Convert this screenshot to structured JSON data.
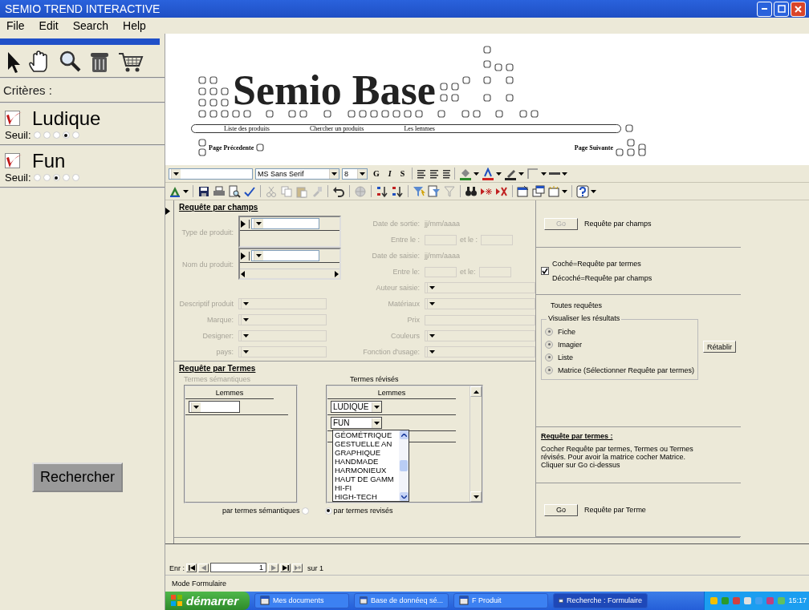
{
  "window": {
    "title": "SEMIO TREND INTERACTIVE"
  },
  "menu": [
    {
      "label": "File"
    },
    {
      "label": "Edit"
    },
    {
      "label": "Search"
    },
    {
      "label": "Help"
    }
  ],
  "criteria_panel": {
    "heading": "Critères :",
    "criteria": [
      {
        "name": "Ludique",
        "checked": true,
        "threshold_label": "Seuil:",
        "threshold": [
          {
            "selected": false
          },
          {
            "selected": false
          },
          {
            "selected": false
          },
          {
            "selected": true
          },
          {
            "selected": false
          }
        ]
      },
      {
        "name": "Fun",
        "checked": true,
        "threshold_label": "Seuil:",
        "threshold": [
          {
            "selected": false
          },
          {
            "selected": false
          },
          {
            "selected": true
          },
          {
            "selected": false
          },
          {
            "selected": false
          }
        ]
      }
    ],
    "search_button": "Rechercher"
  },
  "header": {
    "logo": "Semio Base",
    "nav_links": [
      "Liste des produits",
      "Chercher un produits",
      "Les lemmes"
    ],
    "previous_page": "Page Précedente",
    "next_page": "Page Suivante"
  },
  "format_toolbar": {
    "font": "MS Sans Serif",
    "size": "8",
    "style_buttons": [
      "G",
      "I",
      "S"
    ]
  },
  "form": {
    "fields_query": {
      "title": "Requête par champs",
      "left_fields": [
        {
          "kind": "subform",
          "label": "Type de produit:",
          "disabled": true
        },
        {
          "kind": "subform_scroll",
          "label": "Nom du produit:",
          "disabled": true
        },
        {
          "kind": "combo",
          "label": "Descriptif produit",
          "disabled": true
        },
        {
          "kind": "combo",
          "label": "Marque:",
          "disabled": true
        },
        {
          "kind": "combo",
          "label": "Designer:",
          "disabled": true
        },
        {
          "kind": "combo",
          "label": "pays:",
          "disabled": true
        }
      ],
      "right_fields": [
        {
          "kind": "hint",
          "label": "Date de sortie:",
          "hint": "jj/mm/aaaa",
          "disabled": true
        },
        {
          "kind": "range",
          "label": "Entre le :",
          "label_2": "et le :",
          "disabled": true
        },
        {
          "kind": "hint",
          "label": "Date de saisie:",
          "hint": "jj/mm/aaaa",
          "disabled": true
        },
        {
          "kind": "range",
          "label": "Entre le:",
          "label_2": "et le:",
          "disabled": true
        },
        {
          "kind": "combo",
          "label": "Auteur saisie:",
          "disabled": true
        },
        {
          "kind": "combo",
          "label": "Matériaux",
          "disabled": true
        },
        {
          "kind": "text",
          "label": "Prix",
          "disabled": true
        },
        {
          "kind": "combo",
          "label": "Couleurs",
          "disabled": true
        },
        {
          "kind": "combo",
          "label": "Fonction d'usage:",
          "disabled": true
        }
      ]
    },
    "terms_query": {
      "title": "Requête par Termes",
      "semantic": {
        "label": "Termes sémantiques",
        "disabled": true,
        "column": "Lemmes"
      },
      "revised": {
        "label": "Termes révisés",
        "column": "Lemmes",
        "rows": [
          "LUDIQUE",
          "FUN"
        ],
        "dropdown": [
          "GÉOMÉTRIQUE",
          "GESTUELLE AN",
          "GRAPHIQUE",
          "HANDMADE",
          "HARMONIEUX",
          "HAUT DE GAMM",
          "HI-FI",
          "HIGH-TECH"
        ]
      },
      "modes": [
        {
          "label": "par termes sémantiques",
          "selected": false
        },
        {
          "label": "par termes revisés",
          "selected": true
        }
      ]
    },
    "side": [
      {
        "kind": "go",
        "button": "Go",
        "disabled": true,
        "label": "Requête par champs"
      },
      {
        "kind": "checkbox",
        "checked": true,
        "lines": [
          "Coché=Requête par termes",
          "Décoché=Requête par champs"
        ]
      },
      {
        "kind": "view",
        "title": "Toutes requêtes",
        "group": "Visualiser les résultats",
        "options": [
          {
            "label": "Fiche",
            "selected": true
          },
          {
            "label": "Imagier",
            "selected": true
          },
          {
            "label": "Liste",
            "selected": true
          },
          {
            "label": "Matrice  (Sélectionner Requête par termes)",
            "selected": true
          }
        ],
        "button": "Rétablir"
      },
      {
        "kind": "help",
        "title": "Requête par termes :",
        "text": "Cocher Requête par termes, Termes  ou Termes\nrévisés. Pour avoir la matrice cocher Matrice.\nCliquer sur Go ci-dessus"
      },
      {
        "kind": "go",
        "button": "Go",
        "disabled": false,
        "label": "Requête par Terme"
      }
    ]
  },
  "record_nav": {
    "label": "Enr :",
    "current": "1",
    "total": "sur 1"
  },
  "status_bar": {
    "mode": "Mode Formulaire"
  },
  "taskbar": {
    "start": "démarrer",
    "tasks": [
      {
        "label": "Mes documents",
        "selected": false
      },
      {
        "label": "Base de donnéeq sé...",
        "selected": false
      },
      {
        "label": "F Produit",
        "selected": false
      },
      {
        "label": "Recherche : Formulaire",
        "selected": true
      }
    ],
    "clock": "15:17"
  }
}
